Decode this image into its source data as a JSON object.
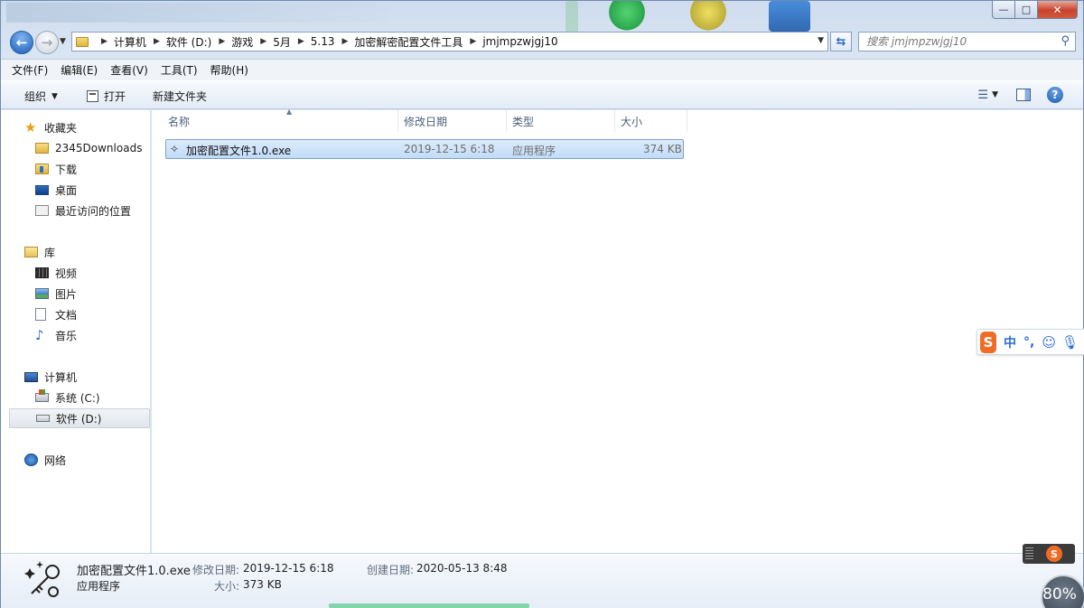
{
  "window": {
    "controls": {
      "minimize": "—",
      "maximize": "□",
      "close": "✕"
    }
  },
  "nav": {
    "back_icon": "back-arrow-icon",
    "forward_icon": "forward-arrow-icon",
    "breadcrumbs": [
      "计算机",
      "软件 (D:)",
      "游戏",
      "5月",
      "5.13",
      "加密解密配置文件工具",
      "jmjmpzwjgj10"
    ],
    "search_placeholder": "搜索 jmjmpzwjgj10"
  },
  "menu": [
    "文件(F)",
    "编辑(E)",
    "查看(V)",
    "工具(T)",
    "帮助(H)"
  ],
  "toolbar": {
    "organize": "组织",
    "open": "打开",
    "new_folder": "新建文件夹"
  },
  "sidebar": {
    "favorites": {
      "label": "收藏夹",
      "items": [
        "2345Downloads",
        "下载",
        "桌面",
        "最近访问的位置"
      ]
    },
    "libraries": {
      "label": "库",
      "items": [
        "视频",
        "图片",
        "文档",
        "音乐"
      ]
    },
    "computer": {
      "label": "计算机",
      "items": [
        "系统 (C:)",
        "软件 (D:)"
      ],
      "selected": "软件 (D:)"
    },
    "network": {
      "label": "网络"
    }
  },
  "columns": [
    "名称",
    "修改日期",
    "类型",
    "大小"
  ],
  "files": [
    {
      "name": "加密配置文件1.0.exe",
      "modified": "2019-12-15 6:18",
      "type": "应用程序",
      "size": "374 KB",
      "selected": true
    }
  ],
  "details": {
    "name": "加密配置文件1.0.exe",
    "type": "应用程序",
    "modified_label": "修改日期:",
    "modified": "2019-12-15 6:18",
    "created_label": "创建日期:",
    "created": "2020-05-13 8:48",
    "size_label": "大小:",
    "size": "373 KB"
  },
  "ime": {
    "logo": "S",
    "mode": "中",
    "punct": "°,",
    "emoji_icon": "smiley-icon",
    "mic_icon": "microphone-icon"
  },
  "speed_ball": {
    "percent": "80%"
  },
  "colors": {
    "selection": "#c2dcf7",
    "accent": "#2a6ed3",
    "sogou": "#f06c26"
  }
}
